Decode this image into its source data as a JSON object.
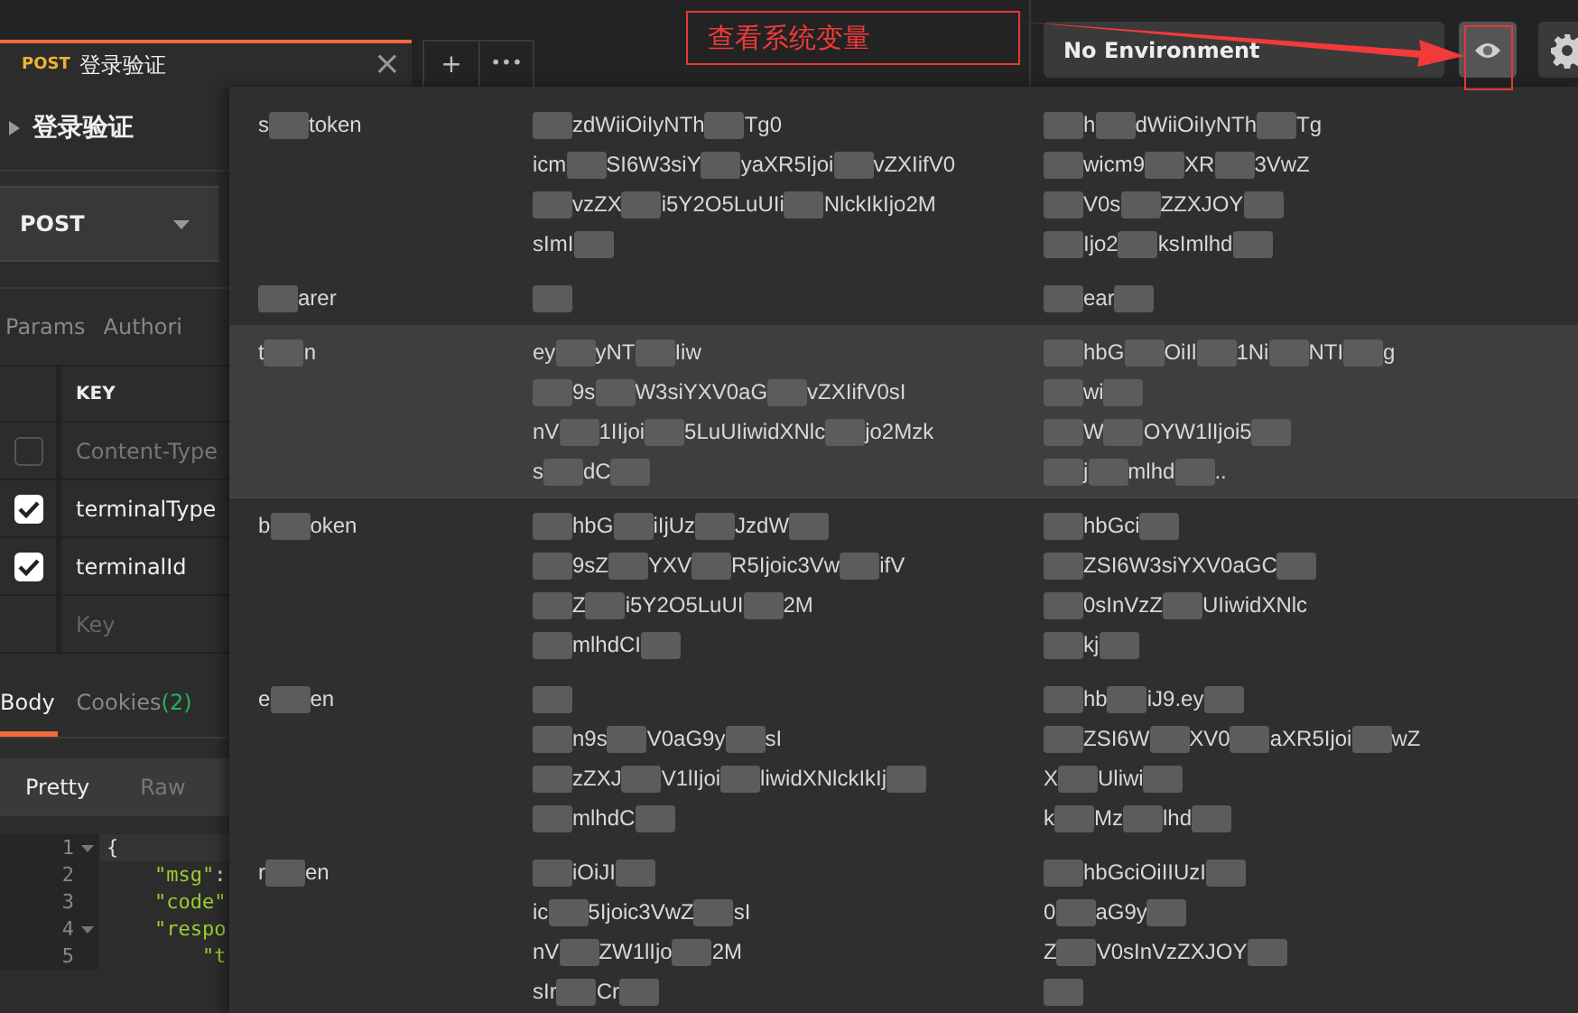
{
  "tab": {
    "method": "POST",
    "title": "登录验证",
    "close": "×",
    "selected": true
  },
  "tab_actions": [
    "+",
    "•••"
  ],
  "annotation": {
    "text": "查看系统变量"
  },
  "environment": {
    "value": "No Environment"
  },
  "request": {
    "name": "登录验证",
    "method": "POST",
    "tabs": [
      {
        "label": "Params",
        "selected": false
      },
      {
        "label": "Authori",
        "selected": false
      }
    ],
    "headers": {
      "column": "KEY",
      "placeholder": "Key",
      "rows": [
        {
          "key": "Content-Type",
          "checked": false
        },
        {
          "key": "terminalType",
          "checked": true
        },
        {
          "key": "terminalId",
          "checked": true
        }
      ]
    }
  },
  "response": {
    "tabs": [
      {
        "label": "Body",
        "selected": true
      },
      {
        "label": "Cookies",
        "count": "(2)",
        "selected": false
      }
    ],
    "formats": [
      {
        "label": "Pretty",
        "selected": true
      },
      {
        "label": "Raw",
        "selected": false
      }
    ],
    "code": [
      {
        "number": "1",
        "fold": true,
        "parts": [
          {
            "kind": "punct",
            "text": "{"
          }
        ]
      },
      {
        "number": "2",
        "fold": false,
        "parts": [
          {
            "kind": "string",
            "text": "    \"msg\""
          },
          {
            "kind": "punct",
            "text": ":"
          }
        ]
      },
      {
        "number": "3",
        "fold": false,
        "parts": [
          {
            "kind": "string",
            "text": "    \"code\""
          }
        ]
      },
      {
        "number": "4",
        "fold": true,
        "parts": [
          {
            "kind": "string",
            "text": "    \"respo"
          }
        ]
      },
      {
        "number": "5",
        "fold": false,
        "parts": [
          {
            "kind": "string",
            "text": "        \"t"
          }
        ]
      }
    ]
  },
  "variables": [
    {
      "highlighted": false,
      "key": [
        "s",
        {
          "kind": "mask"
        },
        "token"
      ],
      "initial": [
        [
          {
            "kind": "mask"
          },
          "zdWiiOiIyNTh",
          {
            "kind": "mask"
          },
          "Tg0"
        ],
        [
          "icm",
          {
            "kind": "mask"
          },
          "SI6W3siY",
          {
            "kind": "mask"
          },
          "yaXR5Ijoi",
          {
            "kind": "mask"
          },
          "vZXIifV0"
        ],
        [
          {
            "kind": "mask"
          },
          "vzZX",
          {
            "kind": "mask"
          },
          "i5Y2O5LuUIi",
          {
            "kind": "mask"
          },
          "NlckIkIjo2M"
        ],
        [
          "sImI",
          {
            "kind": "mask"
          }
        ]
      ],
      "current": [
        [
          {
            "kind": "mask"
          },
          "h",
          {
            "kind": "mask"
          },
          "dWiiOiIyNTh",
          {
            "kind": "mask"
          },
          "Tg"
        ],
        [
          {
            "kind": "mask"
          },
          "wicm9",
          {
            "kind": "mask"
          },
          "XR",
          {
            "kind": "mask"
          },
          "3VwZ"
        ],
        [
          {
            "kind": "mask"
          },
          "V0s",
          {
            "kind": "mask"
          },
          "ZZXJOY",
          {
            "kind": "mask"
          }
        ],
        [
          {
            "kind": "mask"
          },
          "Ijo2",
          {
            "kind": "mask"
          },
          "ksImlhd",
          {
            "kind": "mask"
          }
        ]
      ]
    },
    {
      "highlighted": false,
      "key": [
        {
          "kind": "mask"
        },
        "arer"
      ],
      "initial": [
        [
          {
            "kind": "mask"
          }
        ]
      ],
      "current": [
        [
          {
            "kind": "mask"
          },
          "ear",
          {
            "kind": "mask"
          }
        ]
      ]
    },
    {
      "highlighted": true,
      "key": [
        "t",
        {
          "kind": "mask"
        },
        "n"
      ],
      "initial": [
        [
          "ey",
          {
            "kind": "mask"
          },
          "yNT",
          {
            "kind": "mask"
          },
          "Iiw"
        ],
        [
          {
            "kind": "mask"
          },
          "9s",
          {
            "kind": "mask"
          },
          "W3siYXV0aG",
          {
            "kind": "mask"
          },
          "vZXIifV0sI"
        ],
        [
          "nV",
          {
            "kind": "mask"
          },
          "1IIjoi",
          {
            "kind": "mask"
          },
          "5LuUIiwidXNlc",
          {
            "kind": "mask"
          },
          "jo2Mzk"
        ],
        [
          "s",
          {
            "kind": "mask"
          },
          "dC",
          {
            "kind": "mask"
          }
        ]
      ],
      "current": [
        [
          {
            "kind": "mask"
          },
          "hbG",
          {
            "kind": "mask"
          },
          "OiIl",
          {
            "kind": "mask"
          },
          "1Ni",
          {
            "kind": "mask"
          },
          "NTI",
          {
            "kind": "mask"
          },
          "g"
        ],
        [
          {
            "kind": "mask"
          },
          "wi",
          {
            "kind": "mask"
          }
        ],
        [
          {
            "kind": "mask"
          },
          "W",
          {
            "kind": "mask"
          },
          "OYW1lIjoi5",
          {
            "kind": "mask"
          }
        ],
        [
          {
            "kind": "mask"
          },
          "j",
          {
            "kind": "mask"
          },
          "mlhd",
          {
            "kind": "mask"
          },
          ".."
        ]
      ]
    },
    {
      "highlighted": false,
      "key": [
        "b",
        {
          "kind": "mask"
        },
        "oken"
      ],
      "initial": [
        [
          {
            "kind": "mask"
          },
          "hbG",
          {
            "kind": "mask"
          },
          "iIjUz",
          {
            "kind": "mask"
          },
          "JzdW",
          {
            "kind": "mask"
          }
        ],
        [
          {
            "kind": "mask"
          },
          "9sZ",
          {
            "kind": "mask"
          },
          "YXV",
          {
            "kind": "mask"
          },
          "R5Ijoic3Vw",
          {
            "kind": "mask"
          },
          "ifV"
        ],
        [
          {
            "kind": "mask"
          },
          "Z",
          {
            "kind": "mask"
          },
          "i5Y2O5LuUI",
          {
            "kind": "mask"
          },
          "2M"
        ],
        [
          {
            "kind": "mask"
          },
          "mlhdCI",
          {
            "kind": "mask"
          }
        ]
      ],
      "current": [
        [
          {
            "kind": "mask"
          },
          "hbGci",
          {
            "kind": "mask"
          }
        ],
        [
          {
            "kind": "mask"
          },
          "ZSI6W3siYXV0aGC",
          {
            "kind": "mask"
          }
        ],
        [
          {
            "kind": "mask"
          },
          "0sInVzZ",
          {
            "kind": "mask"
          },
          "UIiwidXNlc"
        ],
        [
          {
            "kind": "mask"
          },
          "kj",
          {
            "kind": "mask"
          }
        ]
      ]
    },
    {
      "highlighted": false,
      "key": [
        "e",
        {
          "kind": "mask"
        },
        "en"
      ],
      "initial": [
        [
          {
            "kind": "mask"
          }
        ],
        [
          {
            "kind": "mask"
          },
          "n9s",
          {
            "kind": "mask"
          },
          "V0aG9y",
          {
            "kind": "mask"
          },
          "sI"
        ],
        [
          {
            "kind": "mask"
          },
          "zZXJ",
          {
            "kind": "mask"
          },
          "V1lIjoi",
          {
            "kind": "mask"
          },
          "liwidXNlckIkIj",
          {
            "kind": "mask"
          }
        ],
        [
          {
            "kind": "mask"
          },
          "mlhdC",
          {
            "kind": "mask"
          }
        ]
      ],
      "current": [
        [
          {
            "kind": "mask"
          },
          "hb",
          {
            "kind": "mask"
          },
          "iJ9.ey",
          {
            "kind": "mask"
          }
        ],
        [
          {
            "kind": "mask"
          },
          "ZSI6W",
          {
            "kind": "mask"
          },
          "XV0",
          {
            "kind": "mask"
          },
          "aXR5Ijoi",
          {
            "kind": "mask"
          },
          "wZ"
        ],
        [
          "X",
          {
            "kind": "mask"
          },
          "Uliwi",
          {
            "kind": "mask"
          }
        ],
        [
          "k",
          {
            "kind": "mask"
          },
          "Mz",
          {
            "kind": "mask"
          },
          "lhd",
          {
            "kind": "mask"
          }
        ]
      ]
    },
    {
      "highlighted": false,
      "key": [
        "r",
        {
          "kind": "mask"
        },
        "en"
      ],
      "initial": [
        [
          {
            "kind": "mask"
          },
          "iOiJI",
          {
            "kind": "mask"
          }
        ],
        [
          "ic",
          {
            "kind": "mask"
          },
          "5Ijoic3VwZ",
          {
            "kind": "mask"
          },
          "sI"
        ],
        [
          "nV",
          {
            "kind": "mask"
          },
          "ZW1lIjo",
          {
            "kind": "mask"
          },
          "2M"
        ],
        [
          "sIr",
          {
            "kind": "mask"
          },
          "Cr",
          {
            "kind": "mask"
          }
        ]
      ],
      "current": [
        [
          {
            "kind": "mask"
          },
          "hbGciOiIIUzI",
          {
            "kind": "mask"
          }
        ],
        [
          "0",
          {
            "kind": "mask"
          },
          "aG9y",
          {
            "kind": "mask"
          }
        ],
        [
          "Z",
          {
            "kind": "mask"
          },
          "V0sInVzZXJOY",
          {
            "kind": "mask"
          }
        ],
        [
          {
            "kind": "mask"
          }
        ]
      ]
    }
  ]
}
